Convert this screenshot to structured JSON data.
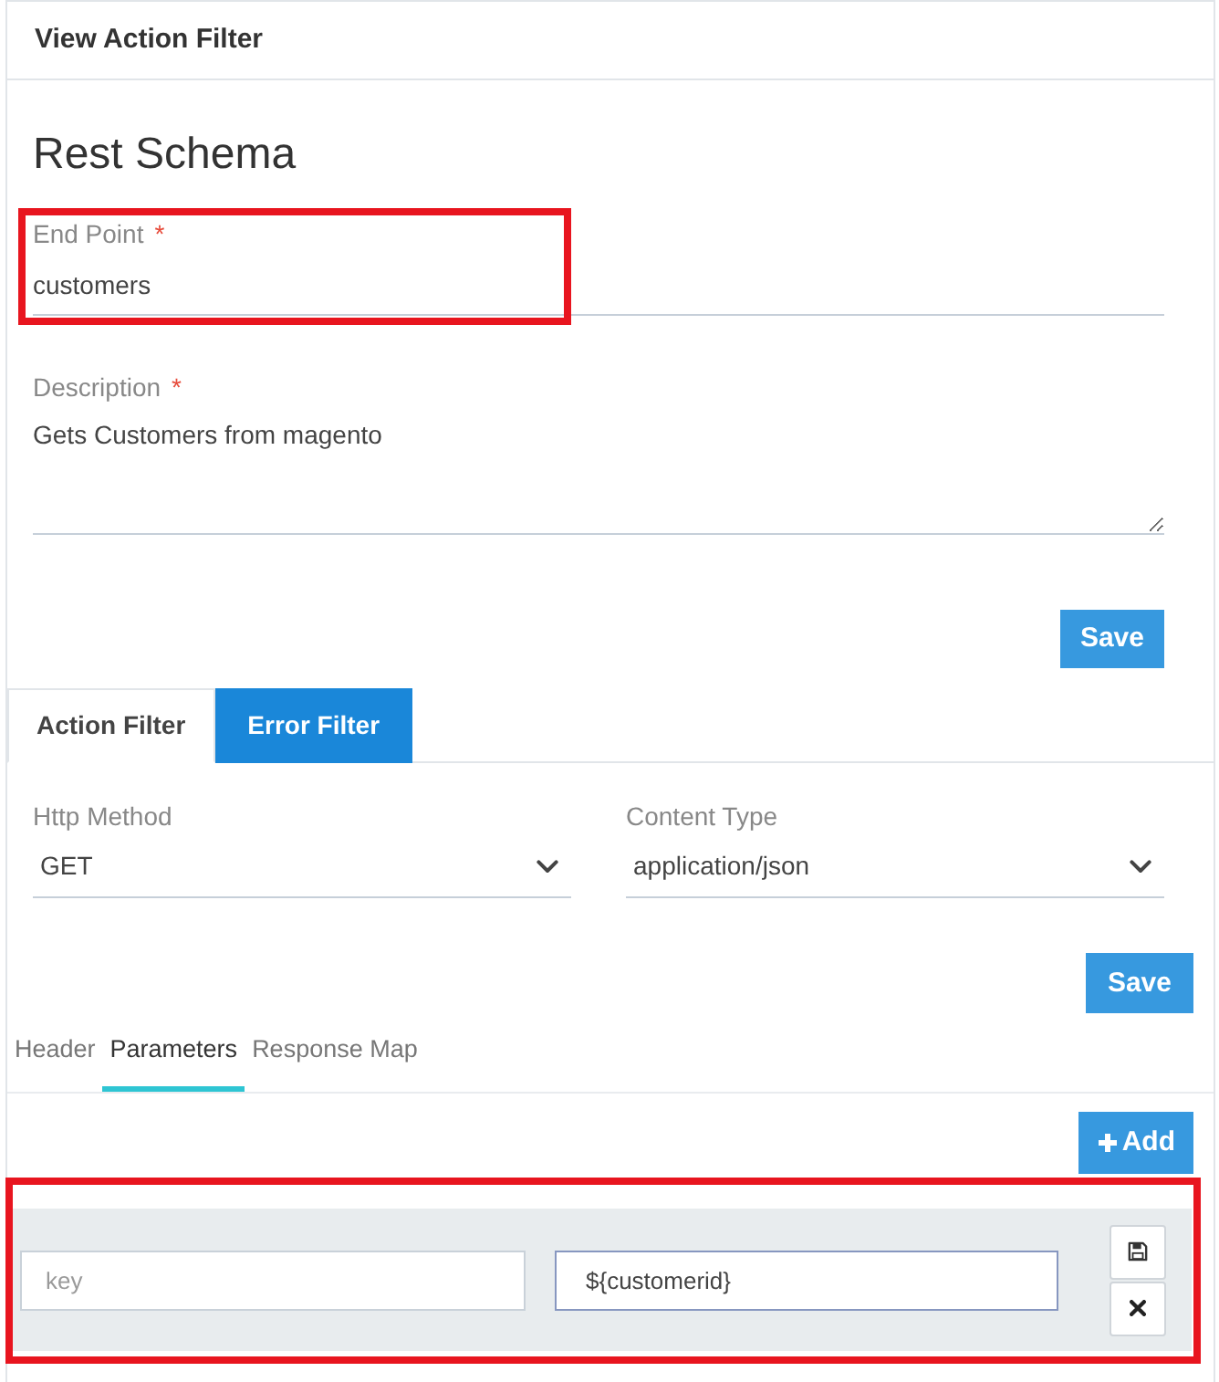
{
  "card": {
    "title": "View Action Filter"
  },
  "schema": {
    "heading": "Rest Schema",
    "end_point": {
      "label": "End Point",
      "required_mark": "*",
      "value": "customers",
      "highlighted": true
    },
    "description": {
      "label": "Description",
      "required_mark": "*",
      "value": "Gets Customers from magento"
    },
    "save_button": "Save"
  },
  "tabs": [
    {
      "label": "Action Filter",
      "selected": true
    },
    {
      "label": "Error Filter",
      "selected": false
    }
  ],
  "action_filter": {
    "http_method": {
      "label": "Http Method",
      "value": "GET"
    },
    "content_type": {
      "label": "Content Type",
      "value": "application/json"
    },
    "save_button": "Save"
  },
  "sub_tabs": [
    {
      "label": "Header",
      "selected": false
    },
    {
      "label": "Parameters",
      "selected": true
    },
    {
      "label": "Response Map",
      "selected": false
    }
  ],
  "parameters": {
    "add_button": "Add",
    "highlighted": true,
    "rows": [
      {
        "key_field": {
          "placeholder": "key"
        },
        "value_field": {
          "value": "${customerid}",
          "focused": true
        }
      }
    ]
  }
}
